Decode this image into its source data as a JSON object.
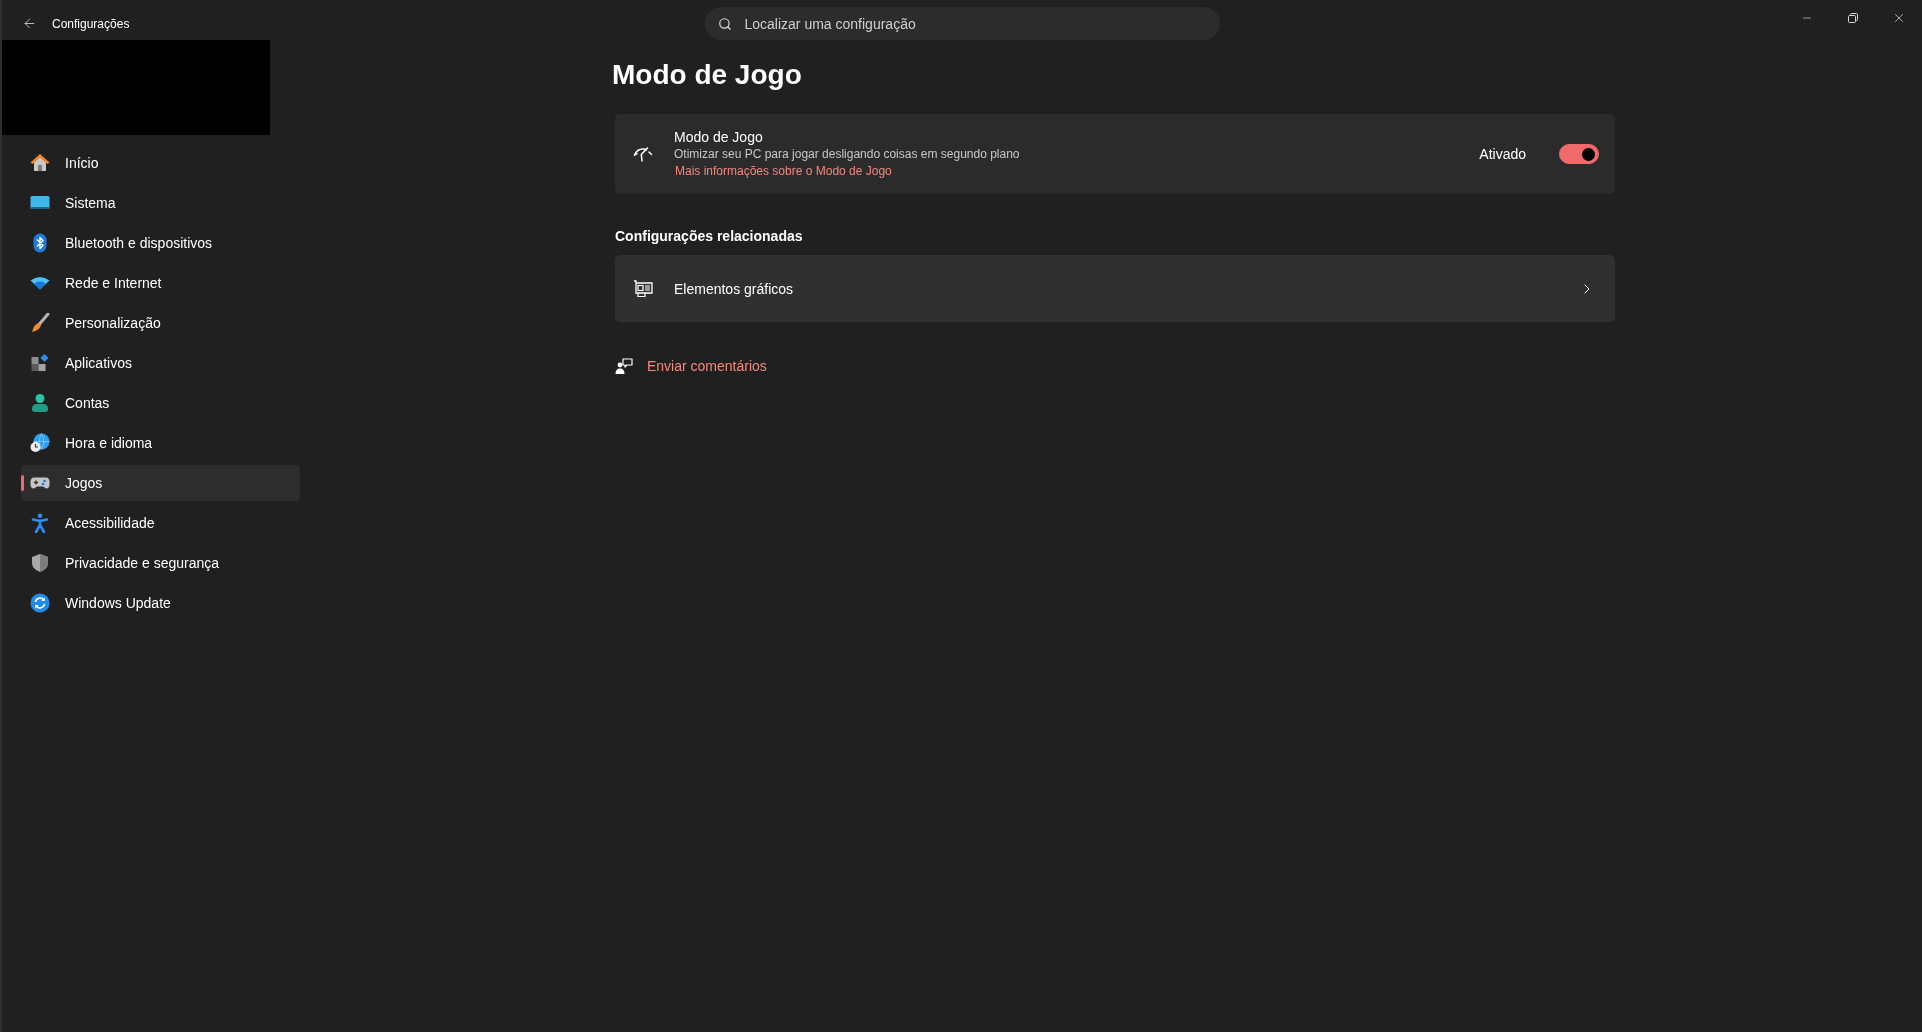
{
  "window": {
    "title": "Configurações"
  },
  "search": {
    "placeholder": "Localizar uma configuração"
  },
  "sidebar": {
    "items": [
      {
        "label": "Início",
        "selected": false
      },
      {
        "label": "Sistema",
        "selected": false
      },
      {
        "label": "Bluetooth e dispositivos",
        "selected": false
      },
      {
        "label": "Rede e Internet",
        "selected": false
      },
      {
        "label": "Personalização",
        "selected": false
      },
      {
        "label": "Aplicativos",
        "selected": false
      },
      {
        "label": "Contas",
        "selected": false
      },
      {
        "label": "Hora e idioma",
        "selected": false
      },
      {
        "label": "Jogos",
        "selected": true
      },
      {
        "label": "Acessibilidade",
        "selected": false
      },
      {
        "label": "Privacidade e segurança",
        "selected": false
      },
      {
        "label": "Windows Update",
        "selected": false
      }
    ]
  },
  "page": {
    "title": "Modo de Jogo"
  },
  "game_mode": {
    "title": "Modo de Jogo",
    "description": "Otimizar seu PC para jogar desligando coisas em segundo plano",
    "link": "Mais informações sobre o Modo de Jogo",
    "state_label": "Ativado",
    "on": true
  },
  "related": {
    "heading": "Configurações relacionadas",
    "items": [
      {
        "label": "Elementos gráficos"
      }
    ]
  },
  "feedback": {
    "label": "Enviar comentários"
  }
}
